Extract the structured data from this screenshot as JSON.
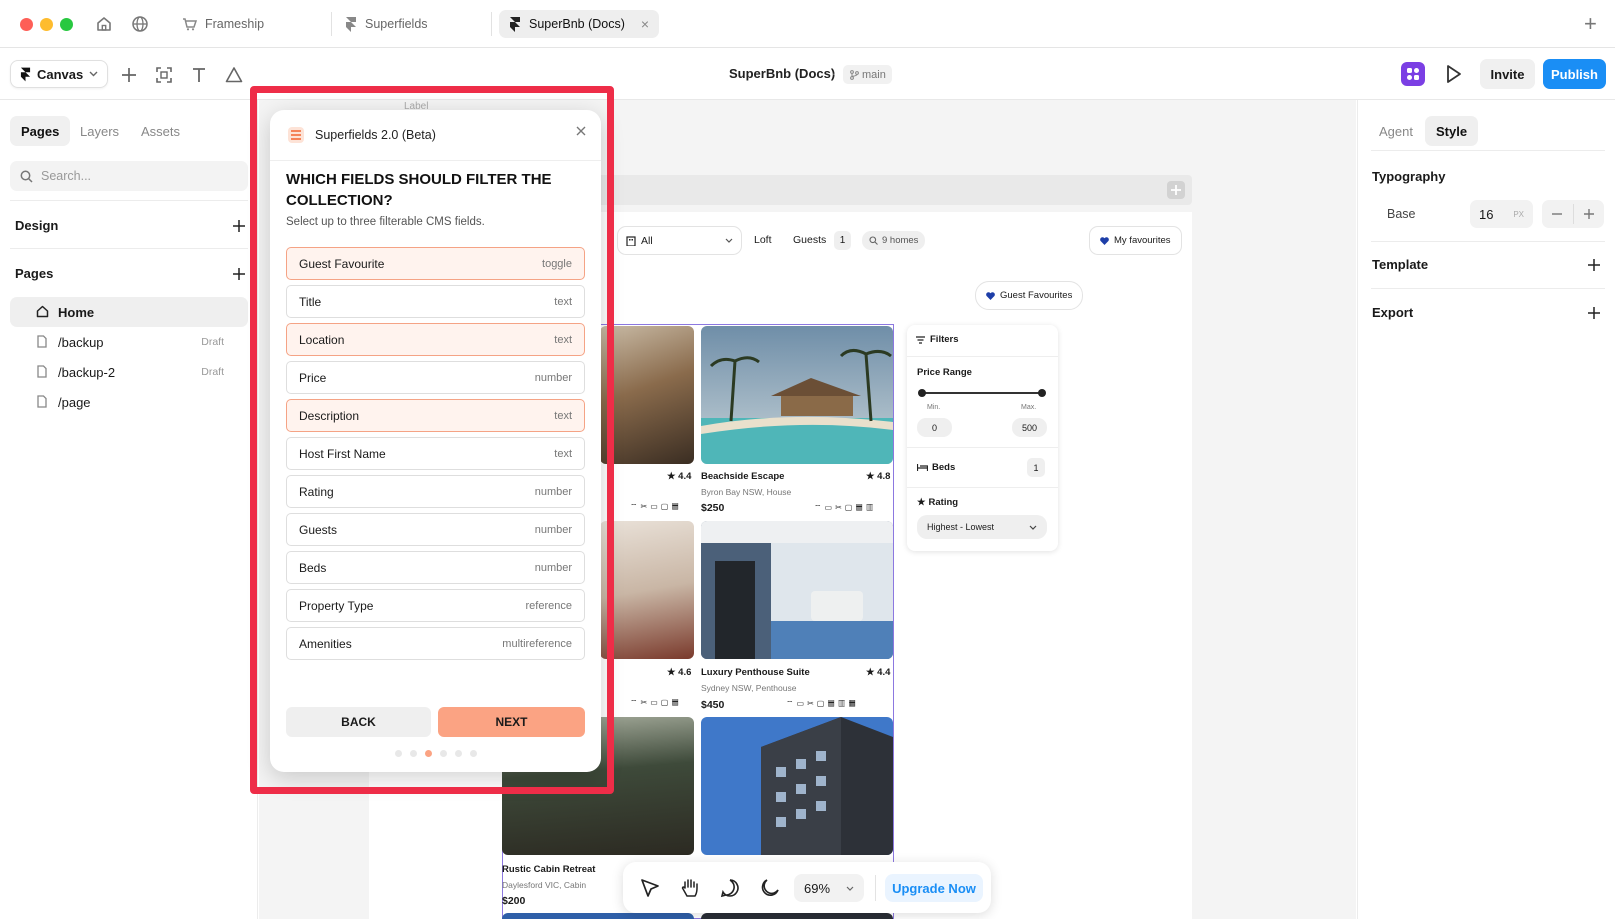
{
  "window": {
    "tabs": [
      {
        "label": "Frameship",
        "icon": "cart-icon"
      },
      {
        "label": "Superfields",
        "icon": "framer-icon"
      },
      {
        "label": "SuperBnb (Docs)",
        "icon": "framer-icon",
        "active": true,
        "close": "×"
      }
    ],
    "new_tab": "+"
  },
  "toolbar": {
    "canvas_label": "Canvas",
    "project_title": "SuperBnb (Docs)",
    "separator": "·",
    "branch": "main",
    "invite_label": "Invite",
    "publish_label": "Publish",
    "accent_color": "#1a8ef5"
  },
  "left_sidebar": {
    "tabs": [
      "Pages",
      "Layers",
      "Assets"
    ],
    "active_tab": "Pages",
    "search_placeholder": "Search...",
    "design_label": "Design",
    "pages_label": "Pages",
    "pages": [
      {
        "label": "Home",
        "icon": "home-icon",
        "active": true,
        "badge": ""
      },
      {
        "label": "/backup",
        "icon": "file-icon",
        "badge": "Draft"
      },
      {
        "label": "/backup-2",
        "icon": "file-icon",
        "badge": "Draft"
      },
      {
        "label": "/page",
        "icon": "file-icon",
        "badge": ""
      }
    ]
  },
  "canvas": {
    "frame_label": "Label",
    "filter_bar": {
      "type_select": "All",
      "type_option": "Loft",
      "guests_label": "Guests",
      "guests_value": "1",
      "homes_count": "9 homes",
      "favourites_button": "My favourites"
    },
    "guest_favourites_chip": "Guest Favourites",
    "filters_panel": {
      "title": "Filters",
      "price_range_label": "Price Range",
      "min_label": "Min.",
      "max_label": "Max.",
      "min_value": "0",
      "max_value": "500",
      "beds_label": "Beds",
      "beds_value": "1",
      "rating_label": "Rating",
      "rating_sort": "Highest - Lowest"
    },
    "listings": [
      {
        "title": "",
        "subtitle": "",
        "price": "",
        "rating": "4.4"
      },
      {
        "title": "Beachside Escape",
        "subtitle": "Byron Bay NSW, House",
        "price": "$250",
        "rating": "4.8"
      },
      {
        "title": "",
        "subtitle": "",
        "price": "",
        "rating": "4.6"
      },
      {
        "title": "Luxury Penthouse Suite",
        "subtitle": "Sydney NSW, Penthouse",
        "price": "$450",
        "rating": "4.4"
      },
      {
        "title": "Rustic Cabin Retreat",
        "subtitle": "Daylesford VIC, Cabin",
        "price": "$200",
        "rating": ""
      }
    ]
  },
  "dialog": {
    "plugin_name": "Superfields 2.0 (Beta)",
    "heading": "WHICH FIELDS SHOULD FILTER THE COLLECTION?",
    "subheading": "Select up to three filterable CMS fields.",
    "fields": [
      {
        "name": "Guest Favourite",
        "type": "toggle",
        "selected": true
      },
      {
        "name": "Title",
        "type": "text",
        "selected": false
      },
      {
        "name": "Location",
        "type": "text",
        "selected": true
      },
      {
        "name": "Price",
        "type": "number",
        "selected": false
      },
      {
        "name": "Description",
        "type": "text",
        "selected": true
      },
      {
        "name": "Host First Name",
        "type": "text",
        "selected": false
      },
      {
        "name": "Rating",
        "type": "number",
        "selected": false
      },
      {
        "name": "Guests",
        "type": "number",
        "selected": false
      },
      {
        "name": "Beds",
        "type": "number",
        "selected": false
      },
      {
        "name": "Property Type",
        "type": "reference",
        "selected": false
      },
      {
        "name": "Amenities",
        "type": "multireference",
        "selected": false
      }
    ],
    "back_label": "BACK",
    "next_label": "NEXT",
    "step_total": 6,
    "step_current": 3,
    "accent_color": "#fba383",
    "highlight_color": "#ee2d48"
  },
  "right_sidebar": {
    "tabs": [
      "Agent",
      "Style"
    ],
    "active_tab": "Style",
    "typography_label": "Typography",
    "base_label": "Base",
    "base_value": "16",
    "base_unit": "PX",
    "template_label": "Template",
    "export_label": "Export"
  },
  "bottom_toolbar": {
    "zoom": "69%",
    "upgrade_label": "Upgrade Now"
  }
}
